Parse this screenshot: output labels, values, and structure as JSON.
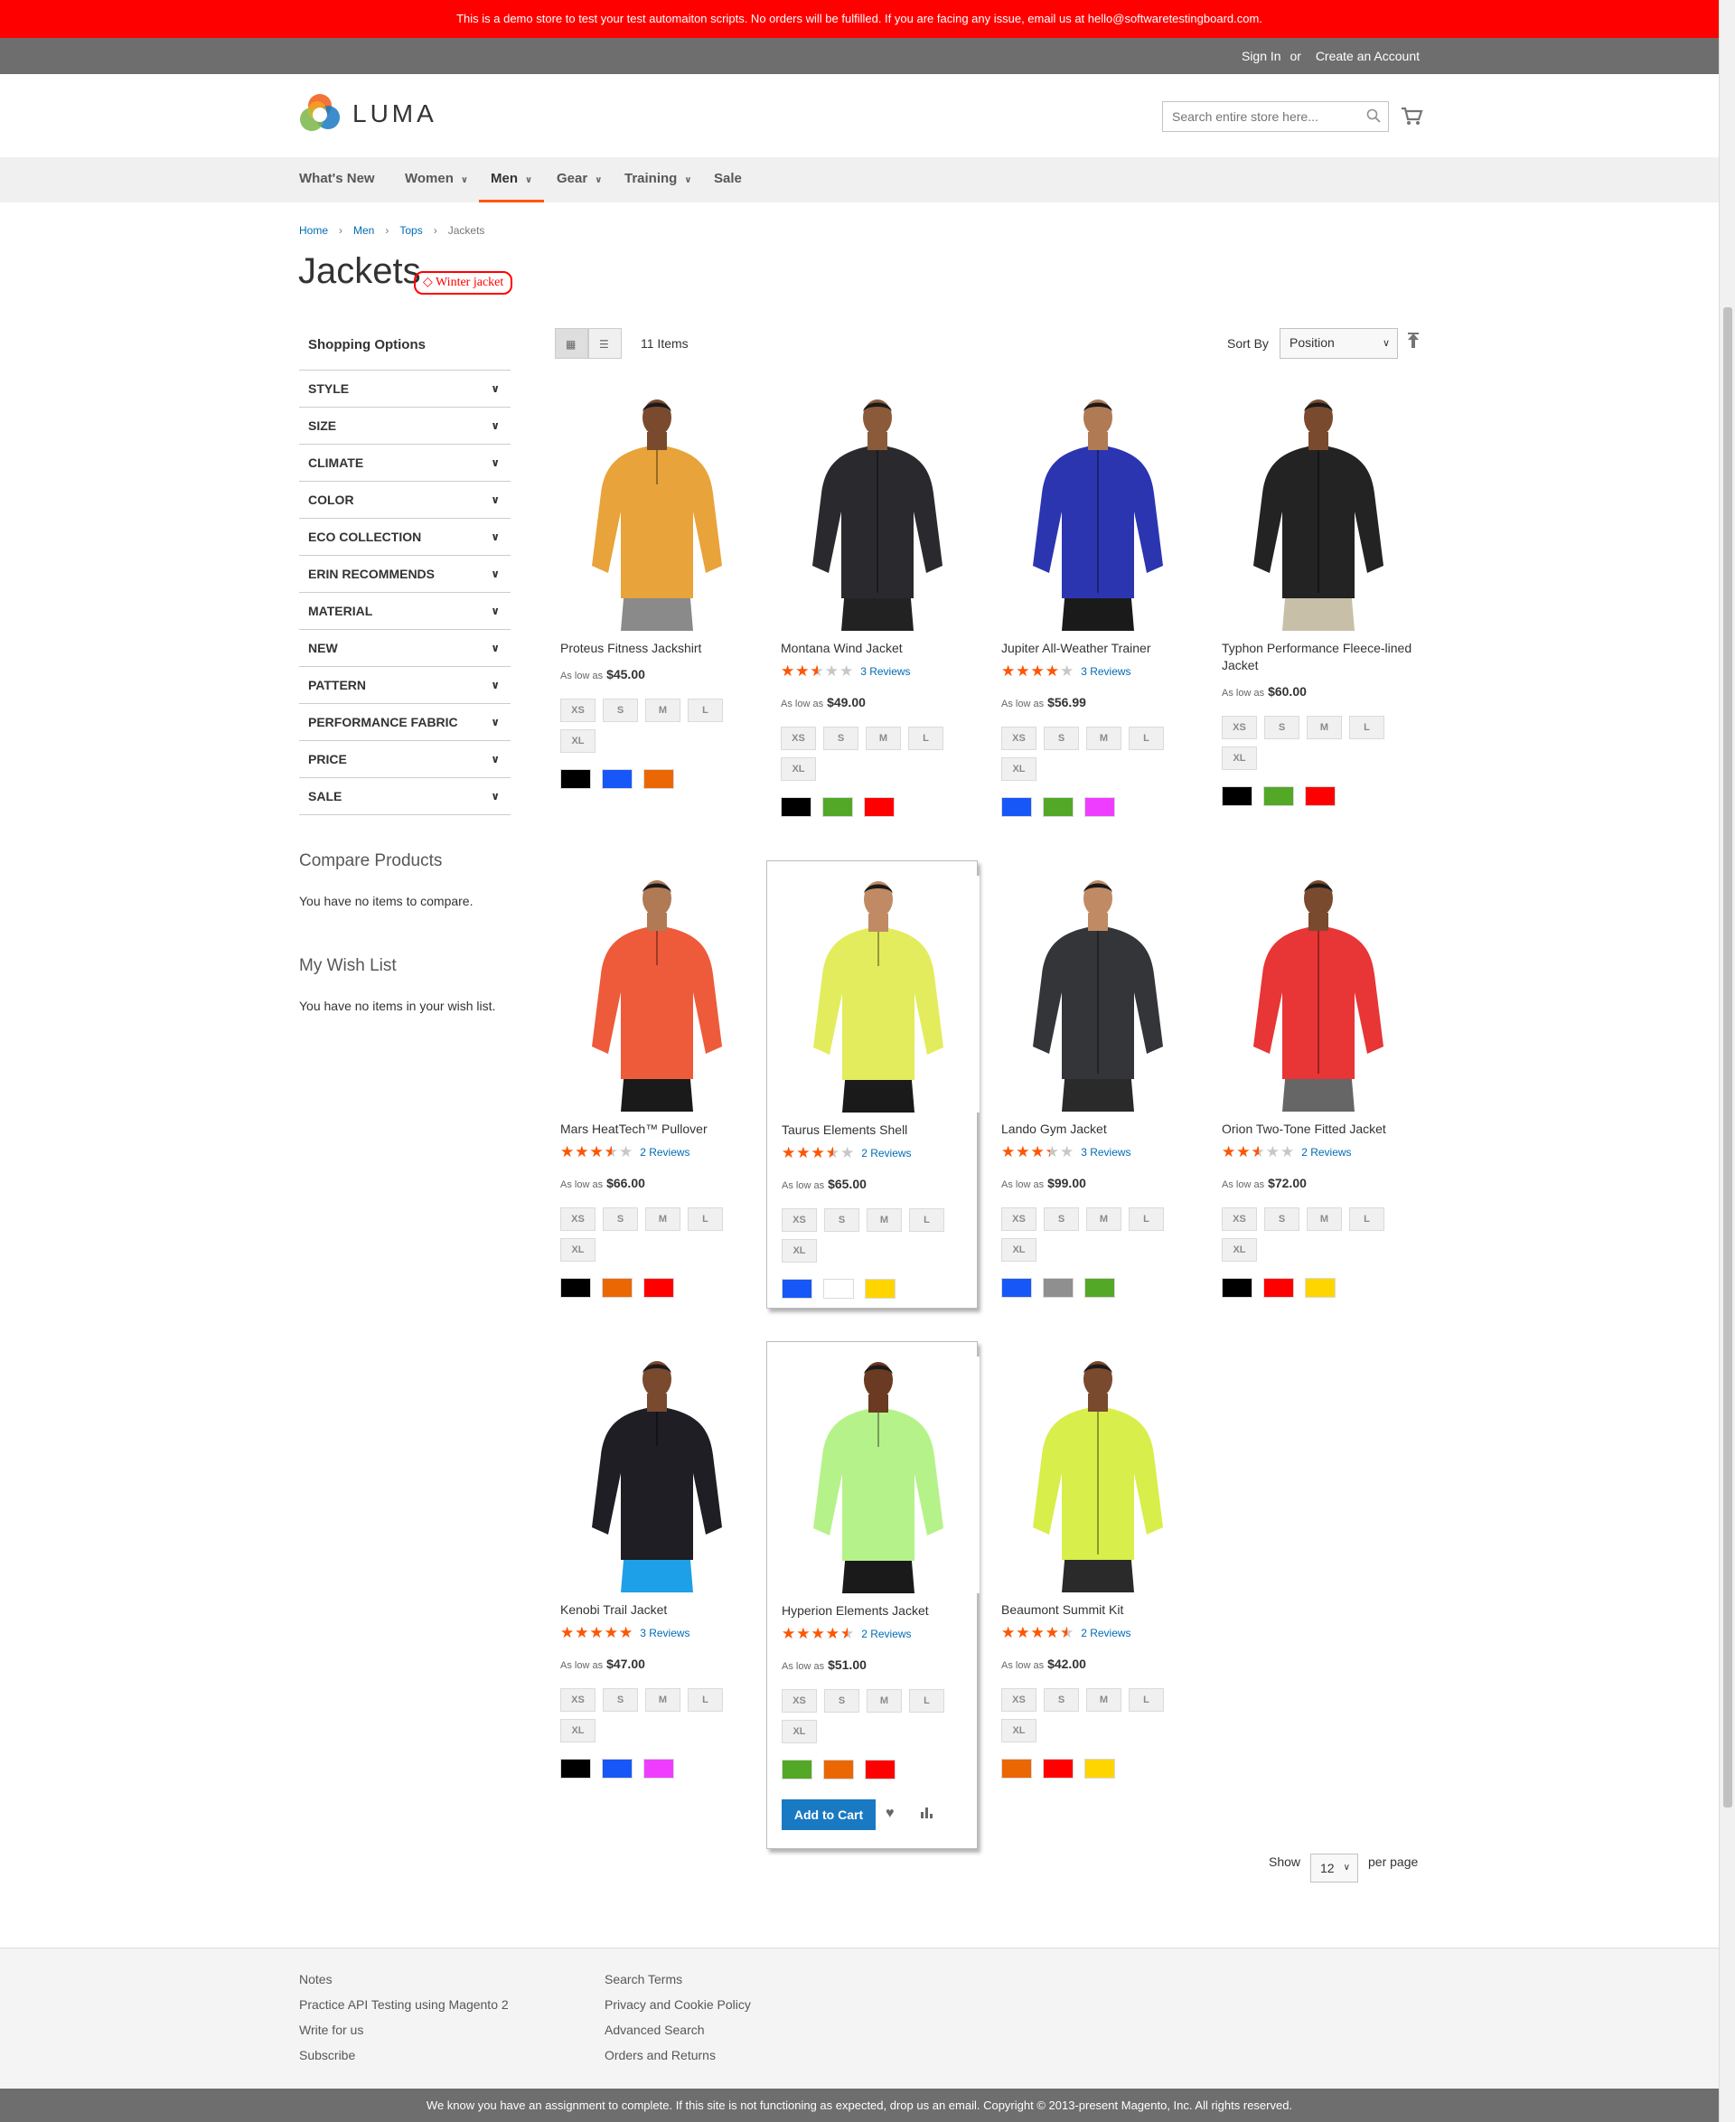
{
  "demo_notice": "This is a demo store to test your test automaiton scripts. No orders will be fulfilled. If you are facing any issue, email us at hello@softwaretestingboard.com.",
  "header_links": {
    "sign_in": "Sign In",
    "or": "or",
    "create_account": "Create an Account"
  },
  "logo": {
    "text": "LUMA"
  },
  "search": {
    "placeholder": "Search entire store here..."
  },
  "nav": [
    {
      "label": "What's New",
      "has_dropdown": false
    },
    {
      "label": "Women",
      "has_dropdown": true
    },
    {
      "label": "Men",
      "has_dropdown": true,
      "active": true
    },
    {
      "label": "Gear",
      "has_dropdown": true
    },
    {
      "label": "Training",
      "has_dropdown": true
    },
    {
      "label": "Sale",
      "has_dropdown": false
    }
  ],
  "breadcrumbs": [
    "Home",
    "Men",
    "Tops",
    "Jackets"
  ],
  "page_title": "Jackets",
  "tag": "Winter jacket",
  "sidebar": {
    "title": "Shopping Options",
    "filters": [
      "Style",
      "Size",
      "Climate",
      "Color",
      "Eco Collection",
      "Erin Recommends",
      "Material",
      "New",
      "Pattern",
      "Performance Fabric",
      "Price",
      "Sale"
    ],
    "compare_title": "Compare Products",
    "compare_text": "You have no items to compare.",
    "wishlist_title": "My Wish List",
    "wishlist_text": "You have no items in your wish list."
  },
  "toolbar": {
    "items_count": "11 Items",
    "sort_label": "Sort By",
    "sort_value": "Position",
    "show_label": "Show",
    "limit_value": "12",
    "per_page": "per page"
  },
  "price_prefix": "As low as",
  "sizes": [
    "XS",
    "S",
    "M",
    "L",
    "XL"
  ],
  "add_to_cart": "Add to Cart",
  "products": [
    {
      "name": "Proteus Fitness Jackshirt",
      "rating": null,
      "reviews": null,
      "price": "$45.00",
      "colors": [
        "#000000",
        "#1857f7",
        "#eb6703"
      ],
      "garment": "#e8a33a",
      "pants": "#8a8a8a",
      "skin": "#7a4a2e"
    },
    {
      "name": "Montana Wind Jacket",
      "rating": 50,
      "reviews": "3 Reviews",
      "price": "$49.00",
      "colors": [
        "#000000",
        "#53a828",
        "#ff0000"
      ],
      "garment": "#2a2a2e",
      "pants": "#222222",
      "skin": "#8a5a3a"
    },
    {
      "name": "Jupiter All-Weather Trainer",
      "rating": 80,
      "reviews": "3 Reviews",
      "price": "$56.99",
      "colors": [
        "#1857f7",
        "#53a828",
        "#ef3dff"
      ],
      "garment": "#2b35b0",
      "pants": "#1a1a1a",
      "skin": "#b07a55"
    },
    {
      "name": "Typhon Performance Fleece-lined Jacket",
      "rating": null,
      "reviews": null,
      "price": "$60.00",
      "colors": [
        "#000000",
        "#53a828",
        "#ff0000"
      ],
      "garment": "#232323",
      "pants": "#c8bfa8",
      "skin": "#7a4a2e"
    },
    {
      "name": "Mars HeatTech™ Pullover",
      "rating": 70,
      "reviews": "2 Reviews",
      "price": "$66.00",
      "colors": [
        "#000000",
        "#eb6703",
        "#ff0000"
      ],
      "garment": "#ee5b3a",
      "pants": "#1a1a1a",
      "skin": "#b07a55"
    },
    {
      "name": "Taurus Elements Shell",
      "rating": 70,
      "reviews": "2 Reviews",
      "price": "$65.00",
      "colors": [
        "#1857f7",
        "#ffffff",
        "#ffd500"
      ],
      "garment": "#e3ec5c",
      "pants": "#1a1a1a",
      "skin": "#c08a65"
    },
    {
      "name": "Lando Gym Jacket",
      "rating": 67,
      "reviews": "3 Reviews",
      "price": "$99.00",
      "colors": [
        "#1857f7",
        "#8f8f8f",
        "#53a828"
      ],
      "garment": "#333538",
      "pants": "#2a2a2a",
      "skin": "#c08a65"
    },
    {
      "name": "Orion Two-Tone Fitted Jacket",
      "rating": 50,
      "reviews": "2 Reviews",
      "price": "$72.00",
      "colors": [
        "#000000",
        "#ff0000",
        "#ffd500"
      ],
      "garment": "#e83535",
      "pants": "#666666",
      "skin": "#7a4a2e"
    },
    {
      "name": "Kenobi Trail Jacket",
      "rating": 100,
      "reviews": "3 Reviews",
      "price": "$47.00",
      "colors": [
        "#000000",
        "#1857f7",
        "#ef3dff"
      ],
      "garment": "#1e1e24",
      "pants": "#1ea0e8",
      "skin": "#7a4a2e"
    },
    {
      "name": "Hyperion Elements Jacket",
      "rating": 90,
      "reviews": "2 Reviews",
      "price": "$51.00",
      "colors": [
        "#53a828",
        "#eb6703",
        "#ff0000"
      ],
      "garment": "#b6f28a",
      "pants": "#1a1a1a",
      "skin": "#6a3a22"
    },
    {
      "name": "Beaumont Summit Kit",
      "rating": 90,
      "reviews": "2 Reviews",
      "price": "$42.00",
      "colors": [
        "#eb6703",
        "#ff0000",
        "#ffd500"
      ],
      "garment": "#d8ee4a",
      "pants": "#2a2a2a",
      "skin": "#7a4a2e"
    }
  ],
  "footer": {
    "col1": [
      "Notes",
      "Practice API Testing using Magento 2",
      "Write for us",
      "Subscribe"
    ],
    "col2": [
      "Search Terms",
      "Privacy and Cookie Policy",
      "Advanced Search",
      "Orders and Returns"
    ]
  },
  "copyright": "We know you have an assignment to complete. If this site is not functioning as expected, drop us an email. Copyright © 2013-present Magento, Inc. All rights reserved.",
  "colors": {
    "accent": "#ff5501",
    "link": "#006bb4",
    "button": "#1979c3",
    "notice": "#ff0000"
  }
}
